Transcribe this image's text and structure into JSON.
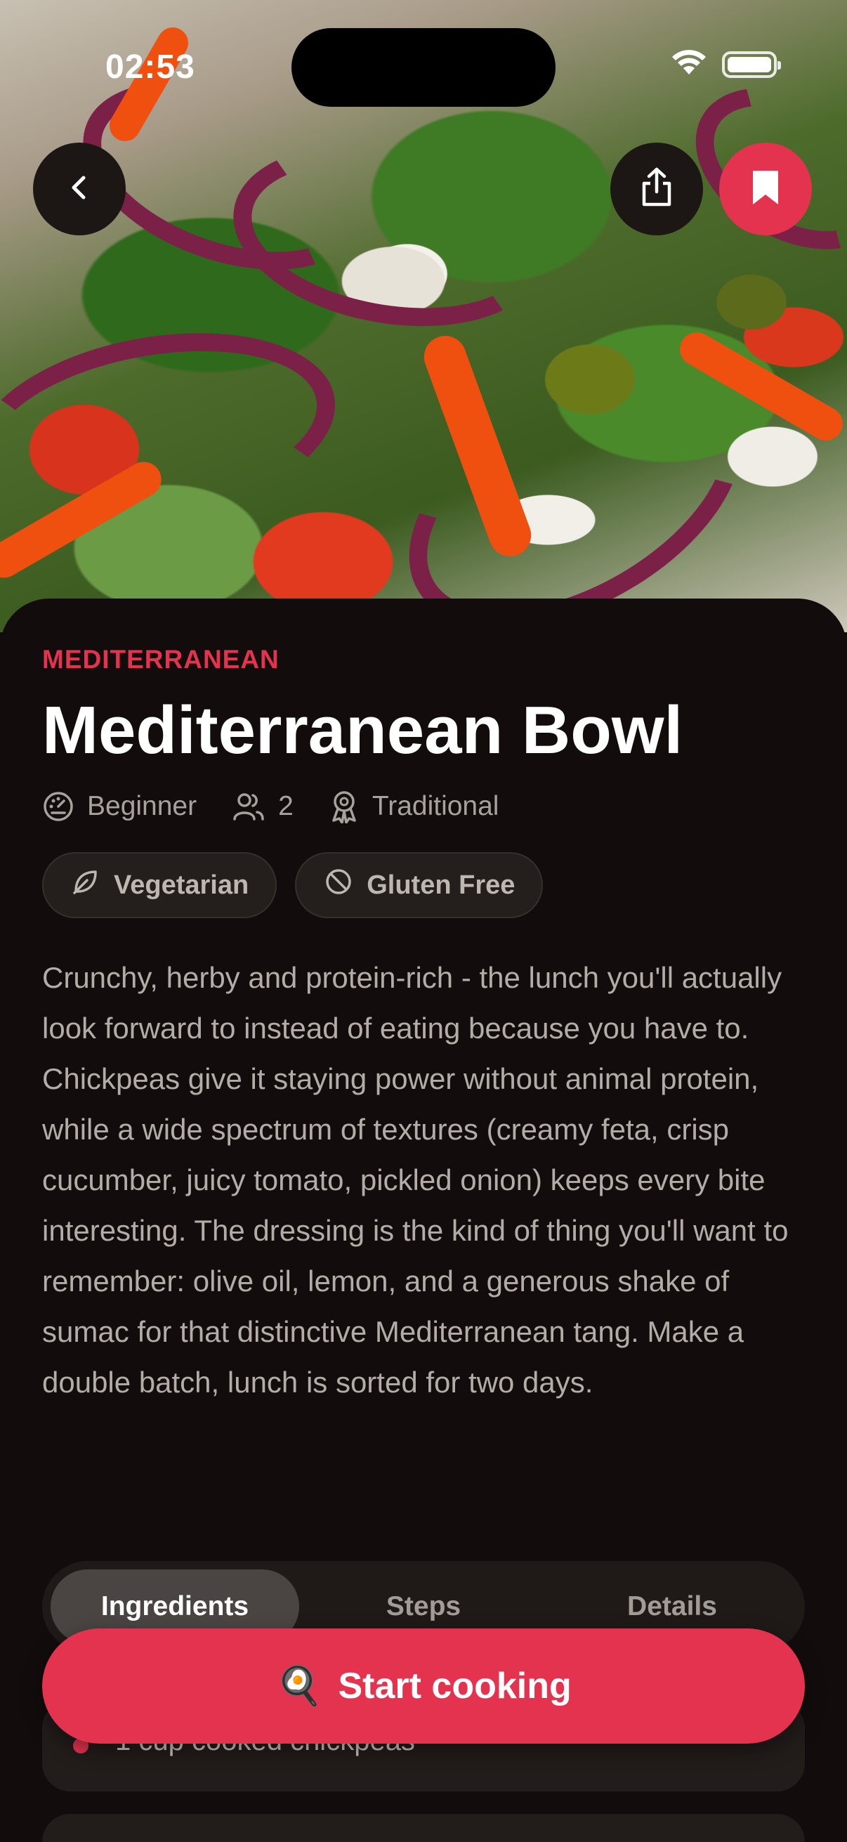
{
  "status_bar": {
    "time": "02:53"
  },
  "hero": {
    "image": "mediterranean-salad-photo"
  },
  "header_buttons": {
    "back_icon": "chevron-left-icon",
    "share_icon": "share-icon",
    "save_icon": "bookmark-icon"
  },
  "recipe": {
    "cuisine": "MEDITERRANEAN",
    "title": "Mediterranean Bowl",
    "meta": {
      "difficulty": "Beginner",
      "servings": "2",
      "style": "Traditional"
    },
    "tags": [
      {
        "label": "Vegetarian",
        "icon": "leaf-icon"
      },
      {
        "label": "Gluten Free",
        "icon": "no-sign-icon"
      }
    ],
    "description": "Crunchy, herby and protein-rich - the lunch you'll actually look forward to instead of eating because you have to. Chickpeas give it staying power without animal protein, while a wide spectrum of textures (creamy feta, crisp cucumber, juicy tomato, pickled onion) keeps every bite interesting. The dressing is the kind of thing you'll want to remember: olive oil, lemon, and a generous shake of sumac for that distinctive Mediterranean tang. Make a double batch, lunch is sorted for two days."
  },
  "tabs": [
    {
      "label": "Ingredients",
      "active": true
    },
    {
      "label": "Steps",
      "active": false
    },
    {
      "label": "Details",
      "active": false
    }
  ],
  "ingredients": [
    {
      "text": "1 cup cooked chickpeas"
    }
  ],
  "cta": {
    "label": "Start cooking",
    "icon": "🍳"
  },
  "colors": {
    "accent": "#e3334f",
    "background": "#120d0c",
    "chip_bg": "#241e1c"
  }
}
